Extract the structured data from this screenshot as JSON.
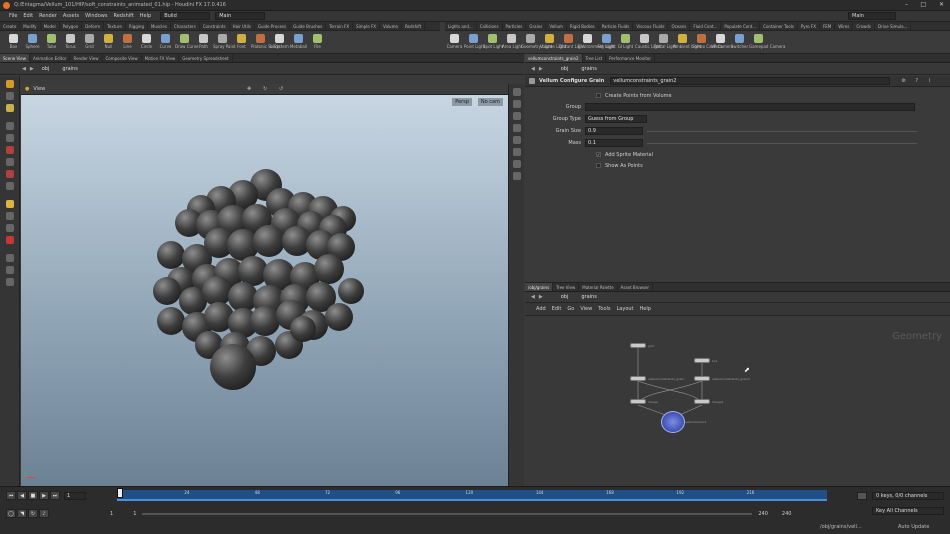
{
  "title": "Q:/Entagma/Vellum_101/HIP/soft_constraints_animated_01.hip - Houdini FX 17.0.416",
  "menu": [
    "File",
    "Edit",
    "Render",
    "Assets",
    "Windows",
    "Redshift",
    "Help"
  ],
  "desktop_combo": "Build",
  "main_combo": "Main",
  "main_combo_right": "Main",
  "shelf_tabs_left": [
    "Create",
    "Modify",
    "Model",
    "Polygon",
    "Deform",
    "Texture",
    "Rigging",
    "Muscles",
    "Characters",
    "Constraints",
    "Hair Utils",
    "Guide Process",
    "Guide Brushes",
    "Terrain FX",
    "Simple FX",
    "Volume",
    "Redshift"
  ],
  "shelf_tabs_right": [
    "Lights and...",
    "Collisions",
    "Particles",
    "Grains",
    "Vellum",
    "Rigid Bodies",
    "Particle Fluids",
    "Viscous Fluids",
    "Oceans",
    "Fluid Cont...",
    "Populate Cont...",
    "Container Tools",
    "Pyro FX",
    "FEM",
    "Wires",
    "Crowds",
    "Drive Simula..."
  ],
  "shelf_tools_left": [
    "Box",
    "Sphere",
    "Tube",
    "Torus",
    "Grid",
    "Null",
    "Line",
    "Circle",
    "Curve",
    "Draw Curve",
    "Path",
    "Spray Paint",
    "Font",
    "Platonic Solids",
    "L-System",
    "Metaball",
    "File"
  ],
  "shelf_tools_right": [
    "Camera",
    "Point Light",
    "Spot Light",
    "Area Light",
    "Geometry Light",
    "Volume Light",
    "Distant Light",
    "Environment Light",
    "Sky Light",
    "GI Light",
    "Caustic Light",
    "Portal Light",
    "Ambient Light",
    "Stereo Camera",
    "VR Camera",
    "Switcher",
    "Gamepad Camera"
  ],
  "left_pane_tabs": [
    "Scene View",
    "Animation Editor",
    "Render View",
    "Composite View",
    "Motion FX View",
    "Geometry Spreadsheet"
  ],
  "left_path": [
    "obj",
    "grains"
  ],
  "viewport_label": "View",
  "viewport_persp": "Persp",
  "viewport_cam": "No cam",
  "right_top_tabs": [
    "vellumconstraints_grain2",
    "Tree List",
    "Performance Monitor"
  ],
  "right_path": [
    "obj",
    "grains"
  ],
  "param": {
    "node_type": "Vellum Configure Grain",
    "node_name": "vellumconstraints_grain2",
    "create_points_label": "Create Points from Volume",
    "group_label": "Group",
    "group_type_label": "Group Type",
    "group_type_value": "Guess from Group",
    "grain_size_label": "Grain Size",
    "grain_size_value": "0.9",
    "mass_label": "Mass",
    "mass_value": "0.1",
    "add_sprite_label": "Add Sprite Material",
    "show_points_label": "Show As Points"
  },
  "net_tabs": [
    "/obj/grains",
    "Tree View",
    "Material Palette",
    "Asset Browser"
  ],
  "net_path": [
    "obj",
    "grains"
  ],
  "net_menu": [
    "Add",
    "Edit",
    "Go",
    "View",
    "Tools",
    "Layout",
    "Help"
  ],
  "net_watermark": "Geometry",
  "nodes": [
    {
      "label": "grid"
    },
    {
      "label": "box"
    },
    {
      "label": "vellumconstraints_grain"
    },
    {
      "label": "vellumconstraints_grain2"
    },
    {
      "label": "merge"
    },
    {
      "label": "merge1"
    },
    {
      "label": "vellumsolver1"
    }
  ],
  "timeline": {
    "frame": "1",
    "start": "1",
    "start2": "1",
    "end": "240",
    "end2": "240",
    "ticks": [
      "24",
      "48",
      "72",
      "96",
      "120",
      "144",
      "168",
      "192",
      "216"
    ],
    "keys_label": "0 keys, 0/0 channels",
    "key_all": "Key All Channels",
    "status_path": "/obj/grains/vell...",
    "auto_update": "Auto Update"
  }
}
